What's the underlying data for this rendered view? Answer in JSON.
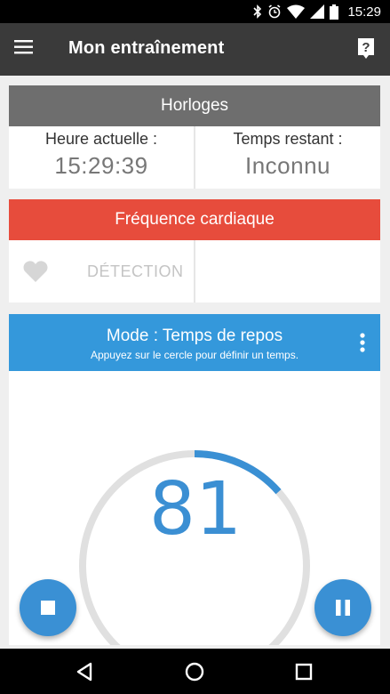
{
  "status_bar": {
    "time": "15:29",
    "icons": [
      "bluetooth-icon",
      "alarm-icon",
      "wifi-icon",
      "signal-icon",
      "battery-icon"
    ]
  },
  "app_bar": {
    "title": "Mon entraînement",
    "menu_icon": "menu-icon",
    "help_icon": "help-icon"
  },
  "clocks": {
    "header": "Horloges",
    "current_time_label": "Heure actuelle :",
    "current_time_value": "15:29:39",
    "remaining_label": "Temps restant :",
    "remaining_value": "Inconnu"
  },
  "heart_rate": {
    "header": "Fréquence cardiaque",
    "detection_label": "DÉTECTION",
    "icon": "heart-icon"
  },
  "mode": {
    "title": "Mode : Temps de repos",
    "subtitle": "Appuyez sur le cercle pour définir un temps.",
    "timer_value": "81",
    "progress_fraction": 0.135
  },
  "controls": {
    "stop_icon": "stop-icon",
    "pause_icon": "pause-icon"
  },
  "nav_bar": {
    "icons": [
      "back-icon",
      "home-icon",
      "recents-icon"
    ]
  },
  "colors": {
    "appbar": "#3a3a3a",
    "clocks_header": "#6e6e6e",
    "heart_header": "#e74c3c",
    "mode_header": "#3498db",
    "accent": "#3a90d4",
    "ring_track": "#e0e0e0"
  }
}
